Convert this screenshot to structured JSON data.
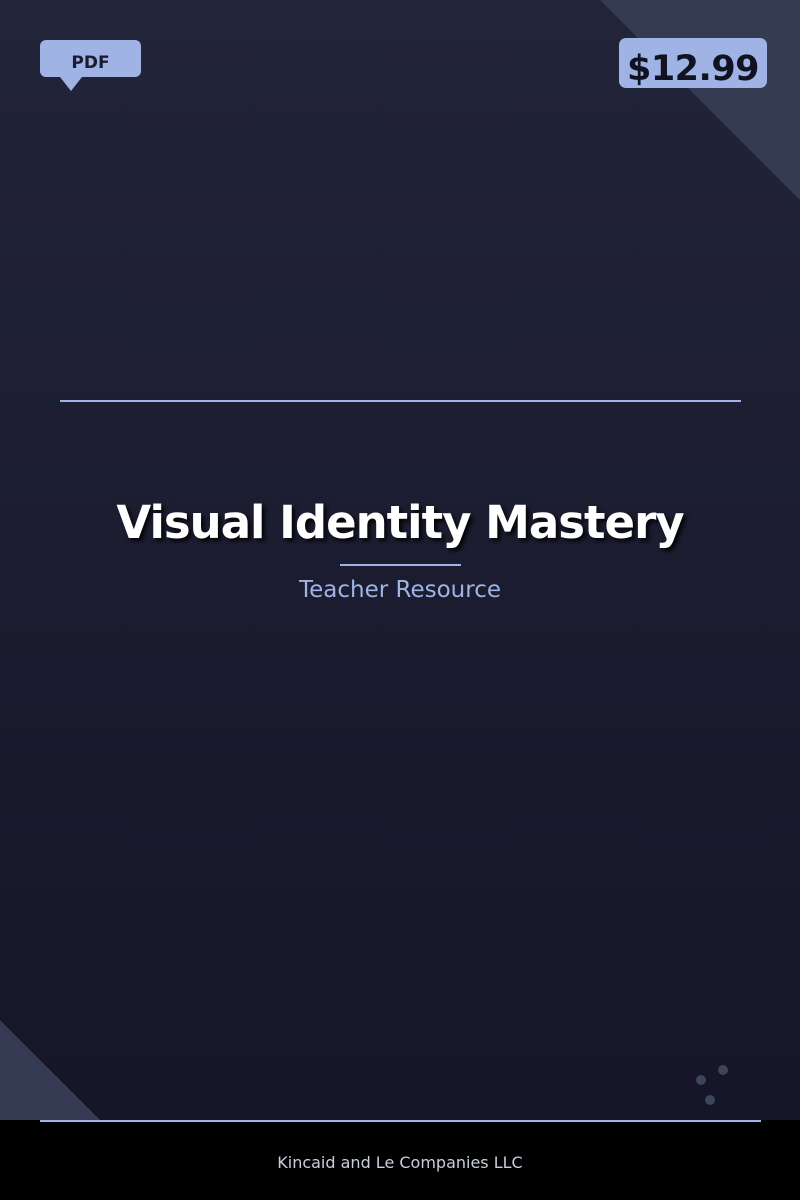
{
  "cover": {
    "format_label": "PDF",
    "price": "$12.99",
    "title": "Visual Identity Mastery",
    "subtitle": "Teacher Resource",
    "publisher": "Kincaid and Le Companies LLC"
  },
  "colors": {
    "background_top": "#22243a",
    "background_bottom": "#141526",
    "accent": "#9fb3e4",
    "corner_shape": "#353b52",
    "footer_background": "#000000",
    "title_text": "#ffffff"
  },
  "icons": {
    "decoration": "dots-cluster-icon"
  }
}
